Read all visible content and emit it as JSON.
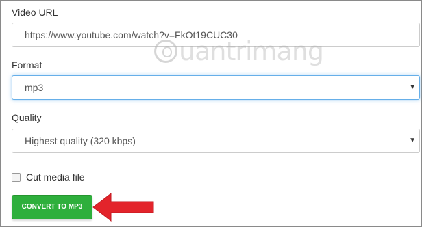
{
  "form": {
    "video_url": {
      "label": "Video URL",
      "value": "https://www.youtube.com/watch?v=FkOt19CUC30"
    },
    "format": {
      "label": "Format",
      "selected": "mp3",
      "caret": "▼"
    },
    "quality": {
      "label": "Quality",
      "selected": "Highest quality (320 kbps)",
      "caret": "▼"
    },
    "cut_media": {
      "label": "Cut media file",
      "checked": false
    },
    "convert_button": {
      "label": "CONVERT TO MP3"
    }
  },
  "watermark": {
    "text": "uantrimang"
  },
  "colors": {
    "button_green": "#2eaf3c",
    "focus_blue": "#66afe9",
    "arrow_red": "#e3242b"
  }
}
